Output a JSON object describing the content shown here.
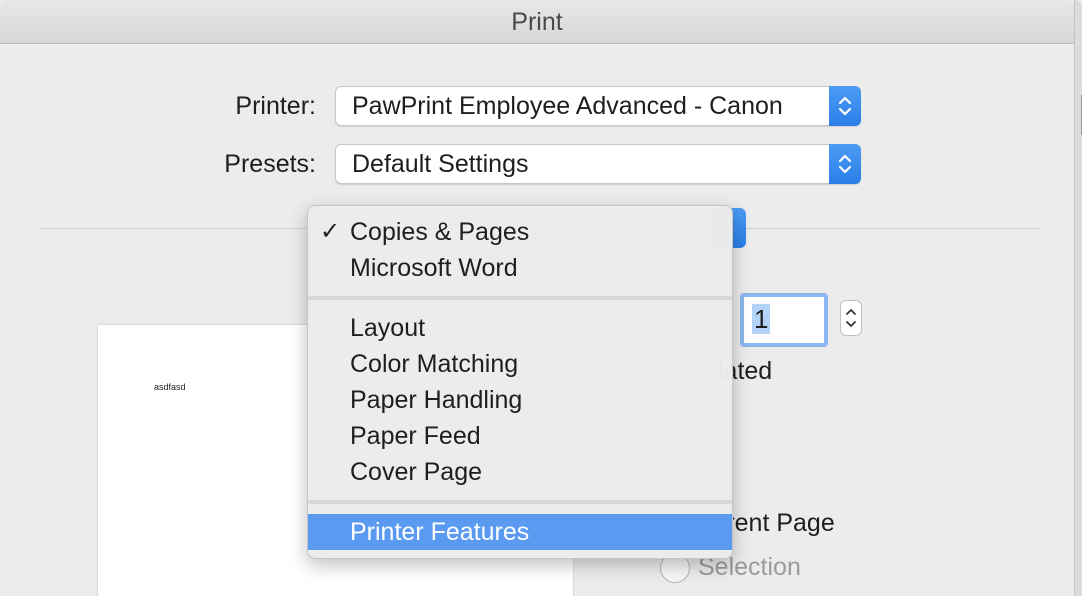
{
  "window": {
    "title": "Print"
  },
  "printer": {
    "label": "Printer:",
    "value": "PawPrint Employee Advanced - Canon"
  },
  "presets": {
    "label": "Presets:",
    "value": "Default Settings"
  },
  "preview": {
    "text": "asdfasd"
  },
  "copies": {
    "value": "1"
  },
  "collated_partial": "lated",
  "current_page_partial": "rrent Page",
  "selection_label": "Selection",
  "menu": {
    "check_glyph": "✓",
    "group1": [
      "Copies & Pages",
      "Microsoft Word"
    ],
    "group2": [
      "Layout",
      "Color Matching",
      "Paper Handling",
      "Paper Feed",
      "Cover Page"
    ],
    "group3": [
      "Printer Features"
    ],
    "checked_item": "Copies & Pages",
    "highlighted_item": "Printer Features"
  },
  "colors": {
    "accent": "#2a7ee8",
    "highlight": "#5a9af0",
    "field_focus": "#8db7ef"
  }
}
